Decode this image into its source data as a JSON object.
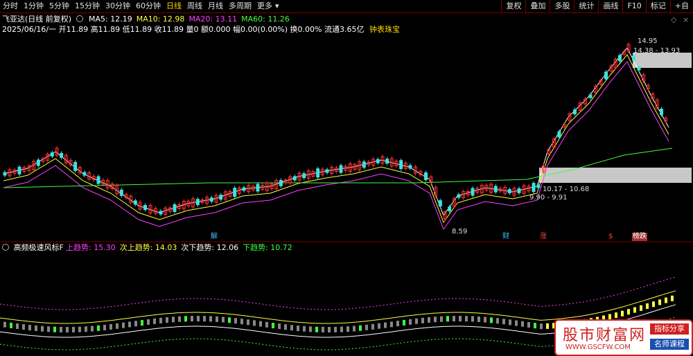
{
  "toolbar": {
    "periods": [
      "分时",
      "1分钟",
      "5分钟",
      "15分钟",
      "30分钟",
      "60分钟",
      "日线",
      "周线",
      "月线",
      "多周期",
      "更多"
    ],
    "active": "日线",
    "more_icon": "dropdown-arrow-icon",
    "buttons": [
      "复权",
      "叠加",
      "多股",
      "统计",
      "画线",
      "F10",
      "标记",
      "+自"
    ]
  },
  "stock": {
    "title": "飞亚达(日线 前复权)",
    "ma": [
      {
        "label": "MA5: 12.19",
        "color": "#ffffff"
      },
      {
        "label": "MA10: 12.98",
        "color": "#ffff40"
      },
      {
        "label": "MA20: 13.11",
        "color": "#ff40ff"
      },
      {
        "label": "MA60: 11.26",
        "color": "#40ff40"
      }
    ],
    "info_line": "2025/06/16/一 开11.89 高11.89 低11.89 收11.89 量0 额0.000 幅0.00(0.00%) 换0.00% 流通3.65亿",
    "link": "钟表珠宝"
  },
  "price_labels": {
    "high": "14.95",
    "zone_top": "14.38 - 13.93",
    "zone_mid": "10.17 - 10.68",
    "zone_low": "9.90 - 9.91",
    "low": "8.59"
  },
  "markers": [
    {
      "text": "解",
      "color": "#40c0ff"
    },
    {
      "text": "财",
      "color": "#40c0ff"
    },
    {
      "text": "涨",
      "color": "#ff4040"
    },
    {
      "text": "$",
      "color": "#ff4040"
    },
    {
      "text": "榜跌",
      "color": "#ffffff"
    }
  ],
  "indicator": {
    "name": "高频极速风标F",
    "values": [
      {
        "label": "上趋势: 15.30",
        "color": "#ff40ff"
      },
      {
        "label": "次上趋势: 14.03",
        "color": "#ffff40"
      },
      {
        "label": "次下趋势: 12.06",
        "color": "#ffffff"
      },
      {
        "label": "下趋势: 10.72",
        "color": "#40ff40"
      }
    ]
  },
  "watermark": {
    "brand": "股市财富网",
    "url": "WWW.GSCFW.COM",
    "tag1": "指标分享",
    "tag2": "名师课程"
  },
  "colors": {
    "up": "#ff3030",
    "down": "#40e0e0",
    "bg": "#000000",
    "zone": "#c8c8c8"
  }
}
